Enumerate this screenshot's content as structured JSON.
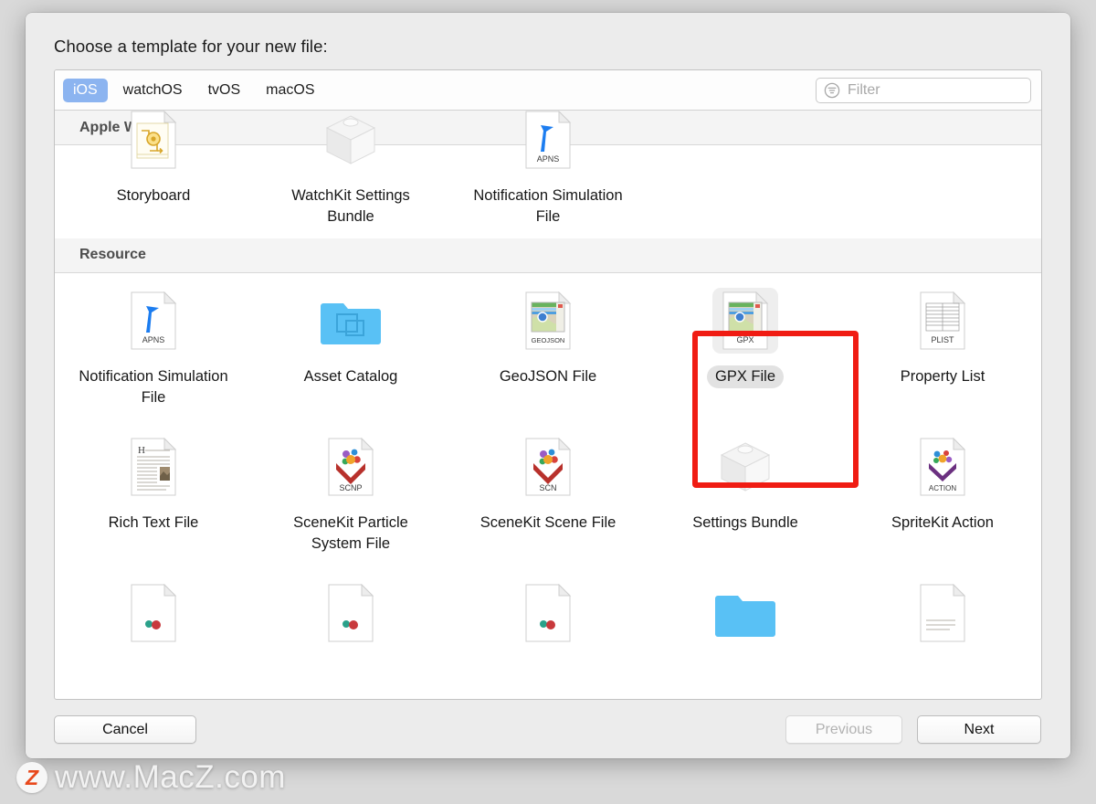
{
  "dialog": {
    "title": "Choose a template for your new file:"
  },
  "tabs": [
    {
      "label": "iOS",
      "active": true
    },
    {
      "label": "watchOS",
      "active": false
    },
    {
      "label": "tvOS",
      "active": false
    },
    {
      "label": "macOS",
      "active": false
    }
  ],
  "filter": {
    "placeholder": "Filter",
    "value": "",
    "icon": "filter-icon"
  },
  "sections": [
    {
      "title": "Apple Watch",
      "clipped_top": true,
      "items": [
        {
          "label": "Storyboard",
          "icon": "storyboard-icon",
          "badge": "",
          "selected": false
        },
        {
          "label": "WatchKit Settings Bundle",
          "icon": "bundle-box-icon",
          "badge": "",
          "selected": false
        },
        {
          "label": "Notification Simulation File",
          "icon": "apns-doc-icon",
          "badge": "APNS",
          "selected": false
        },
        {
          "label": "",
          "icon": "",
          "badge": "",
          "selected": false
        },
        {
          "label": "",
          "icon": "",
          "badge": "",
          "selected": false
        }
      ]
    },
    {
      "title": "Resource",
      "clipped_top": false,
      "items": [
        {
          "label": "Notification Simulation File",
          "icon": "apns-doc-icon",
          "badge": "APNS",
          "selected": false
        },
        {
          "label": "Asset Catalog",
          "icon": "asset-catalog-folder-icon",
          "badge": "",
          "selected": false
        },
        {
          "label": "GeoJSON File",
          "icon": "geojson-doc-icon",
          "badge": "GEOJSON",
          "selected": false
        },
        {
          "label": "GPX File",
          "icon": "gpx-doc-icon",
          "badge": "GPX",
          "selected": true
        },
        {
          "label": "Property List",
          "icon": "plist-doc-icon",
          "badge": "PLIST",
          "selected": false
        },
        {
          "label": "Rich Text File",
          "icon": "rtf-doc-icon",
          "badge": "",
          "selected": false
        },
        {
          "label": "SceneKit Particle System File",
          "icon": "scnp-doc-icon",
          "badge": "SCNP",
          "selected": false
        },
        {
          "label": "SceneKit Scene File",
          "icon": "scn-doc-icon",
          "badge": "SCN",
          "selected": false
        },
        {
          "label": "Settings Bundle",
          "icon": "bundle-box-icon",
          "badge": "",
          "selected": false
        },
        {
          "label": "SpriteKit Action",
          "icon": "action-doc-icon",
          "badge": "ACTION",
          "selected": false
        }
      ]
    }
  ],
  "highlight": {
    "target": "GPX File",
    "color": "#f01c13"
  },
  "footer": {
    "cancel_label": "Cancel",
    "previous_label": "Previous",
    "previous_disabled": true,
    "next_label": "Next"
  },
  "watermark": {
    "logo_letter": "Z",
    "text": "www.MacZ.com",
    "logo_color": "#e8491c"
  }
}
